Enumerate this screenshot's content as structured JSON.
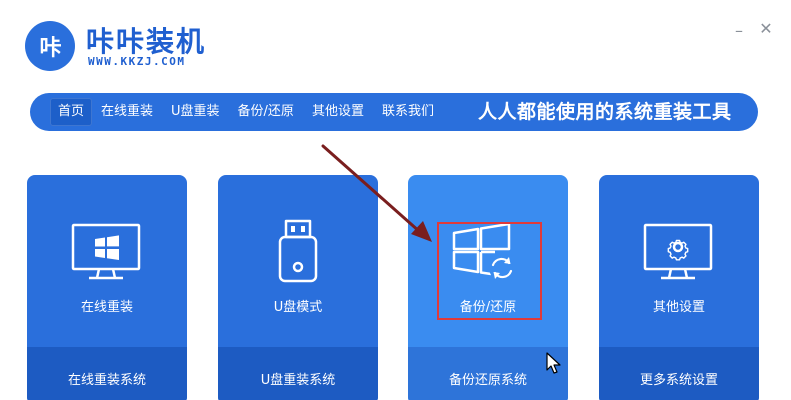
{
  "brand": {
    "logo_text": "咔",
    "title": "咔咔装机",
    "url": "WWW.KKZJ.COM"
  },
  "window": {
    "minimize": "–",
    "close": "✕"
  },
  "nav": {
    "items": [
      {
        "label": "首页",
        "active": true
      },
      {
        "label": "在线重装",
        "active": false
      },
      {
        "label": "U盘重装",
        "active": false
      },
      {
        "label": "备份/还原",
        "active": false
      },
      {
        "label": "其他设置",
        "active": false
      },
      {
        "label": "联系我们",
        "active": false
      }
    ],
    "slogan": "人人都能使用的系统重装工具"
  },
  "cards": [
    {
      "label": "在线重装",
      "footer": "在线重装系统",
      "icon": "monitor-windows-icon"
    },
    {
      "label": "U盘模式",
      "footer": "U盘重装系统",
      "icon": "usb-drive-icon"
    },
    {
      "label": "备份/还原",
      "footer": "备份还原系统",
      "icon": "windows-restore-icon"
    },
    {
      "label": "其他设置",
      "footer": "更多系统设置",
      "icon": "monitor-gear-icon"
    }
  ],
  "colors": {
    "primary": "#2a6fdc",
    "footer": "#1d5bc2",
    "highlight_card": "#3a8cf0",
    "annotation_red": "#e03a3a",
    "annotation_arrow": "#7a1e1e"
  }
}
